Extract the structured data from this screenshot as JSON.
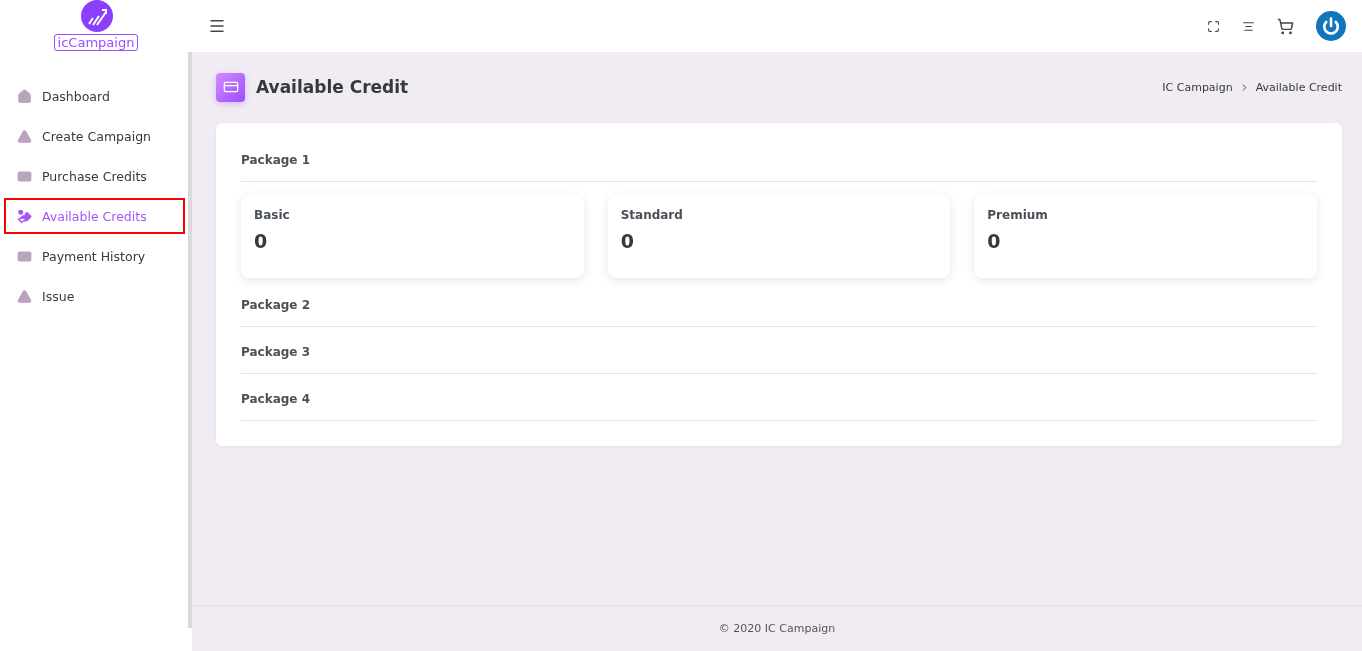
{
  "logo": {
    "text": "icCampaign"
  },
  "sidebar": {
    "items": [
      {
        "label": "Dashboard",
        "selected": false
      },
      {
        "label": "Create Campaign",
        "selected": false
      },
      {
        "label": "Purchase Credits",
        "selected": false
      },
      {
        "label": "Available Credits",
        "selected": true
      },
      {
        "label": "Payment History",
        "selected": false
      },
      {
        "label": "Issue",
        "selected": false
      }
    ]
  },
  "page_header": {
    "title": "Available Credit",
    "breadcrumb": [
      "IC Campaign",
      "Available Credit"
    ]
  },
  "packages": [
    {
      "title": "Package 1",
      "credits": [
        {
          "label": "Basic",
          "value": "0"
        },
        {
          "label": "Standard",
          "value": "0"
        },
        {
          "label": "Premium",
          "value": "0"
        }
      ]
    },
    {
      "title": "Package 2"
    },
    {
      "title": "Package 3"
    },
    {
      "title": "Package 4"
    }
  ],
  "footer": {
    "text": "© 2020 IC Campaign"
  }
}
